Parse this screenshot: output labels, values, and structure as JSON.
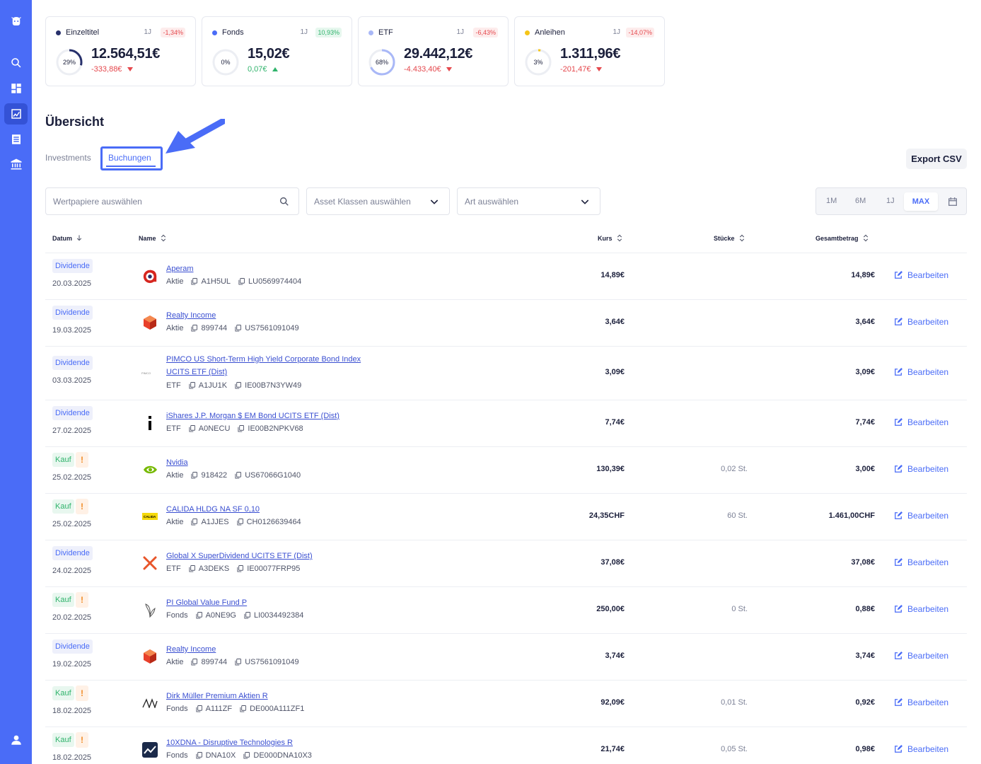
{
  "colors": {
    "brand": "#4a6cf7",
    "positive": "#2fb36b",
    "negative": "#e5484d",
    "warning": "#f08a24"
  },
  "sidebar": {
    "items": [
      {
        "icon": "logo-icon"
      },
      {
        "icon": "search-icon"
      },
      {
        "icon": "dashboard-icon"
      },
      {
        "icon": "chart-icon",
        "active": true
      },
      {
        "icon": "list-icon"
      },
      {
        "icon": "bank-icon"
      },
      {
        "icon": "user-icon"
      }
    ]
  },
  "cards": [
    {
      "name": "Einzeltitel",
      "period": "1J",
      "change": "-1,34%",
      "ring_label": "29%",
      "ring_fraction": 0.29,
      "value": "12.564,51€",
      "delta": "-333,88€",
      "trend": "neg",
      "dot_color": "#27306b",
      "ring_color": "#27306b"
    },
    {
      "name": "Fonds",
      "period": "1J",
      "change": "10,93%",
      "ring_label": "0%",
      "ring_fraction": 0.0,
      "value": "15,02€",
      "delta": "0,07€",
      "trend": "pos",
      "dot_color": "#4a6cf7",
      "ring_color": "#4a6cf7"
    },
    {
      "name": "ETF",
      "period": "1J",
      "change": "-6,43%",
      "ring_label": "68%",
      "ring_fraction": 0.68,
      "value": "29.442,12€",
      "delta": "-4.433,40€",
      "trend": "neg",
      "dot_color": "#a9b8f7",
      "ring_color": "#a9b8f7"
    },
    {
      "name": "Anleihen",
      "period": "1J",
      "change": "-14,07%",
      "ring_label": "3%",
      "ring_fraction": 0.03,
      "value": "1.311,96€",
      "delta": "-201,47€",
      "trend": "neg",
      "dot_color": "#f5c518",
      "ring_color": "#f5c518"
    }
  ],
  "overview": {
    "title": "Übersicht",
    "tabs": [
      {
        "label": "Investments"
      },
      {
        "label": "Buchungen",
        "active": true
      }
    ],
    "export_label": "Export CSV"
  },
  "filters": {
    "securities_placeholder": "Wertpapiere auswählen",
    "asset_classes_placeholder": "Asset Klassen auswählen",
    "type_placeholder": "Art auswählen",
    "ranges": [
      "1M",
      "6M",
      "1J",
      "MAX"
    ],
    "active_range": "MAX"
  },
  "table": {
    "columns": {
      "date": "Datum",
      "name": "Name",
      "kurs": "Kurs",
      "stuecke": "Stücke",
      "gesamt": "Gesamtbetrag"
    },
    "edit_label": "Bearbeiten",
    "rows": [
      {
        "type": "Dividende",
        "warn": false,
        "date": "20.03.2025",
        "logo": "aperam-logo",
        "name": "Aperam",
        "name2": "",
        "class": "Aktie",
        "wkn": "A1H5UL",
        "isin": "LU0569974404",
        "kurs": "14,89€",
        "stuecke": "",
        "gesamt": "14,89€"
      },
      {
        "type": "Dividende",
        "warn": false,
        "date": "19.03.2025",
        "logo": "realty-income-logo",
        "name": "Realty Income",
        "name2": "",
        "class": "Aktie",
        "wkn": "899744",
        "isin": "US7561091049",
        "kurs": "3,64€",
        "stuecke": "",
        "gesamt": "3,64€"
      },
      {
        "type": "Dividende",
        "warn": false,
        "date": "03.03.2025",
        "logo": "pimco-logo",
        "name": "PIMCO US Short-Term High Yield Corporate Bond Index",
        "name2": "UCITS ETF (Dist)",
        "class": "ETF",
        "wkn": "A1JU1K",
        "isin": "IE00B7N3YW49",
        "kurs": "3,09€",
        "stuecke": "",
        "gesamt": "3,09€"
      },
      {
        "type": "Dividende",
        "warn": false,
        "date": "27.02.2025",
        "logo": "ishares-logo",
        "name": "iShares J.P. Morgan $ EM Bond UCITS ETF (Dist)",
        "name2": "",
        "class": "ETF",
        "wkn": "A0NECU",
        "isin": "IE00B2NPKV68",
        "kurs": "7,74€",
        "stuecke": "",
        "gesamt": "7,74€"
      },
      {
        "type": "Kauf",
        "warn": true,
        "date": "25.02.2025",
        "logo": "nvidia-logo",
        "name": "Nvidia",
        "name2": "",
        "class": "Aktie",
        "wkn": "918422",
        "isin": "US67066G1040",
        "kurs": "130,39€",
        "stuecke": "0,02 St.",
        "gesamt": "3,00€"
      },
      {
        "type": "Kauf",
        "warn": true,
        "date": "25.02.2025",
        "logo": "calida-logo",
        "logo_text": "CALIDA",
        "name": "CALIDA HLDG NA SF 0,10",
        "name2": "",
        "class": "Aktie",
        "wkn": "A1JJES",
        "isin": "CH0126639464",
        "kurs": "24,35CHF",
        "stuecke": "60 St.",
        "gesamt": "1.461,00CHF"
      },
      {
        "type": "Dividende",
        "warn": false,
        "date": "24.02.2025",
        "logo": "global-x-logo",
        "name": "Global X SuperDividend UCITS ETF (Dist)",
        "name2": "",
        "class": "ETF",
        "wkn": "A3DEKS",
        "isin": "IE00077FRP95",
        "kurs": "37,08€",
        "stuecke": "",
        "gesamt": "37,08€"
      },
      {
        "type": "Kauf",
        "warn": true,
        "date": "20.02.2025",
        "logo": "pi-global-logo",
        "name": "PI Global Value Fund P",
        "name2": "",
        "class": "Fonds",
        "wkn": "A0NE9G",
        "isin": "LI0034492384",
        "kurs": "250,00€",
        "stuecke": "0 St.",
        "gesamt": "0,88€"
      },
      {
        "type": "Dividende",
        "warn": false,
        "date": "19.02.2025",
        "logo": "realty-income-logo",
        "name": "Realty Income",
        "name2": "",
        "class": "Aktie",
        "wkn": "899744",
        "isin": "US7561091049",
        "kurs": "3,74€",
        "stuecke": "",
        "gesamt": "3,74€"
      },
      {
        "type": "Kauf",
        "warn": true,
        "date": "18.02.2025",
        "logo": "dirk-mueller-logo",
        "name": "Dirk Müller Premium Aktien R",
        "name2": "",
        "class": "Fonds",
        "wkn": "A111ZF",
        "isin": "DE000A111ZF1",
        "kurs": "92,09€",
        "stuecke": "0,01 St.",
        "gesamt": "0,92€"
      },
      {
        "type": "Kauf",
        "warn": true,
        "date": "18.02.2025",
        "logo": "10xdna-logo",
        "name": "10XDNA - Disruptive Technologies R",
        "name2": "",
        "class": "Fonds",
        "wkn": "DNA10X",
        "isin": "DE000DNA10X3",
        "kurs": "21,74€",
        "stuecke": "0,05 St.",
        "gesamt": "0,98€"
      }
    ]
  }
}
